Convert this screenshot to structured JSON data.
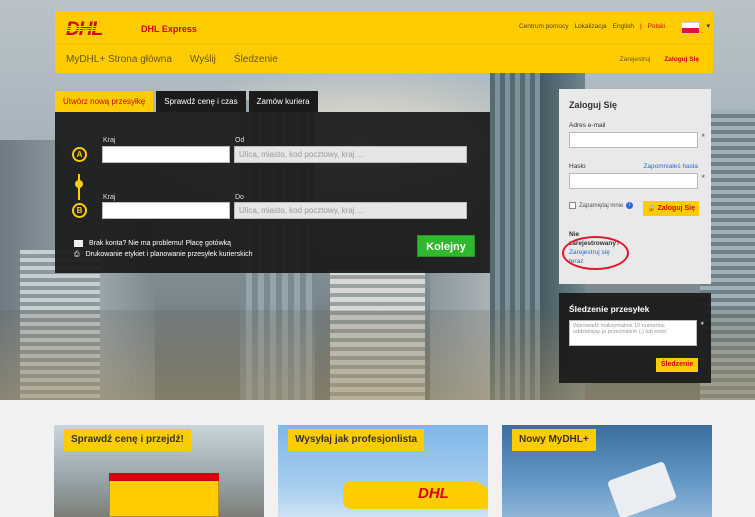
{
  "header": {
    "logo_text": "DHL",
    "brand_sub": "DHL Express",
    "top_links": [
      "Centrum pomocy",
      "Lokalizacja",
      "English",
      "Polski"
    ],
    "nav": [
      "MyDHL+ Strona główna",
      "Wyślij",
      "Śledzenie"
    ],
    "register": "Zarejestruj",
    "login": "Zaloguj Się"
  },
  "shipment": {
    "tabs": [
      "Utwórz nową przesyłkę",
      "Sprawdź cenę i czas",
      "Zamów kuriera"
    ],
    "from": {
      "marker": "A",
      "country_label": "Kraj",
      "city_label": "Od",
      "city_placeholder": "Ulica, miasto, kod pocztowy, kraj ..."
    },
    "to": {
      "marker": "B",
      "country_label": "Kraj",
      "city_label": "Do",
      "city_placeholder": "Ulica, miasto, kod pocztowy, kraj ..."
    },
    "promo": [
      "Brak konta? Nie ma problemu! Płacę gotówką",
      "Drukowanie etykiet i planowanie przesyłek kurierskich"
    ],
    "next_label": "Kolejny"
  },
  "login": {
    "title": "Zaloguj Się",
    "email_label": "Adres e-mail",
    "password_label": "Hasło",
    "forgot": "Zapomniałeś hasła",
    "remember": "Zapamiętaj mnie",
    "button": "Zaloguj Się",
    "no_account_1": "Nie",
    "no_account_2": "zarejestrowany?",
    "register_1": "Zarejestruj się",
    "register_2": "teraz",
    "required_mark": "*"
  },
  "tracking": {
    "title": "Śledzenie przesyłek",
    "placeholder": "Wprowadź maksymalnie 10 numerów, oddzielając je przecinkiem (,) lub enter",
    "button": "Śledzenie",
    "required_mark": "*"
  },
  "cards": [
    "Sprawdź cenę i przejdź!",
    "Wysyłaj jak profesjonlista",
    "Nowy MyDHL+"
  ],
  "colors": {
    "dhl_yellow": "#ffcc00",
    "dhl_red": "#d40511",
    "green": "#2eb82e"
  }
}
